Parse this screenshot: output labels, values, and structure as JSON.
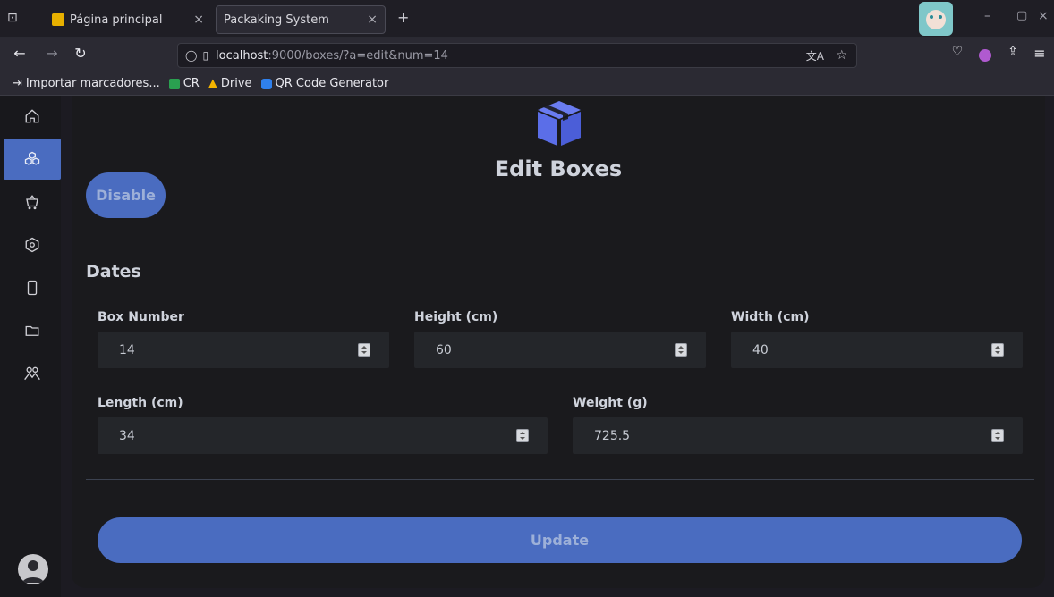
{
  "browser": {
    "tabs": [
      {
        "label": "Página principal"
      },
      {
        "label": "Packaking System"
      }
    ],
    "new_tab_label": "+",
    "url_host": "localhost",
    "url_path": ":9000/boxes/?a=edit&num=14",
    "bookmarks": [
      {
        "label": "Importar marcadores..."
      },
      {
        "label": "CR"
      },
      {
        "label": "Drive"
      },
      {
        "label": "QR Code Generator"
      }
    ]
  },
  "sidebar": {
    "items": [
      {
        "icon": "home-icon"
      },
      {
        "icon": "boxes-icon",
        "active": true
      },
      {
        "icon": "cart-icon"
      },
      {
        "icon": "hexagon-icon"
      },
      {
        "icon": "phone-icon"
      },
      {
        "icon": "folder-icon"
      },
      {
        "icon": "users-icon"
      }
    ],
    "avatar_icon": "user-avatar-icon"
  },
  "page": {
    "title": "Edit Boxes",
    "disable_label": "Disable",
    "section_title": "Dates",
    "update_label": "Update"
  },
  "form": {
    "box_number": {
      "label": "Box Number",
      "value": "14"
    },
    "height": {
      "label": "Height (cm)",
      "value": "60"
    },
    "width": {
      "label": "Width (cm)",
      "value": "40"
    },
    "length": {
      "label": "Length (cm)",
      "value": "34"
    },
    "weight": {
      "label": "Weight (g)",
      "value": "725.5"
    }
  },
  "colors": {
    "accent": "#4a6cc0",
    "box_icon": "#5b6ee8",
    "surface": "#1a1a1d"
  }
}
